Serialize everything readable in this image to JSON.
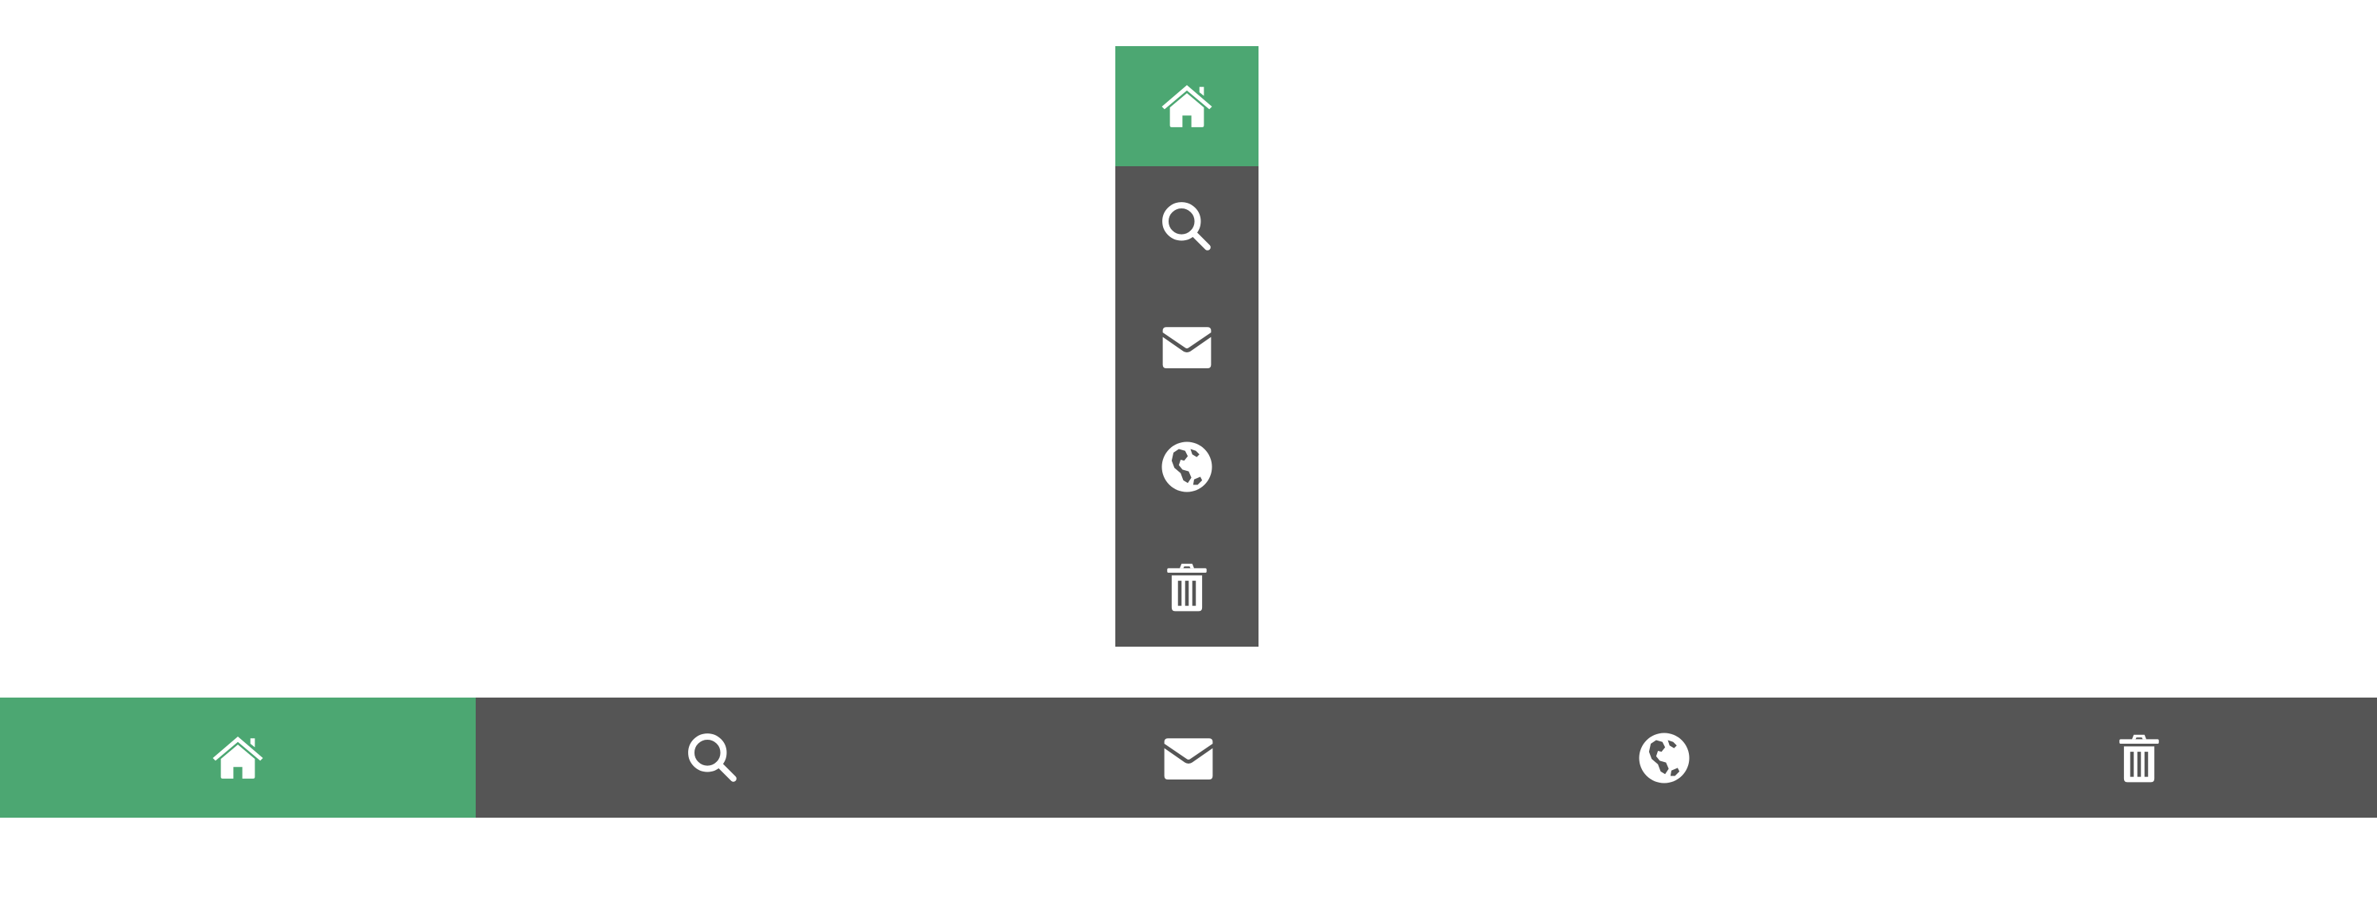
{
  "colors": {
    "bar_background": "#555555",
    "active_background": "#4CA772",
    "icon_color": "#FFFFFF",
    "page_background": "#FFFFFF"
  },
  "vertical_bar": {
    "items": [
      {
        "icon": "home-icon",
        "active": true
      },
      {
        "icon": "search-icon",
        "active": false
      },
      {
        "icon": "envelope-icon",
        "active": false
      },
      {
        "icon": "globe-icon",
        "active": false
      },
      {
        "icon": "trash-icon",
        "active": false
      }
    ]
  },
  "horizontal_bar": {
    "items": [
      {
        "icon": "home-icon",
        "active": true
      },
      {
        "icon": "search-icon",
        "active": false
      },
      {
        "icon": "envelope-icon",
        "active": false
      },
      {
        "icon": "globe-icon",
        "active": false
      },
      {
        "icon": "trash-icon",
        "active": false
      }
    ]
  }
}
